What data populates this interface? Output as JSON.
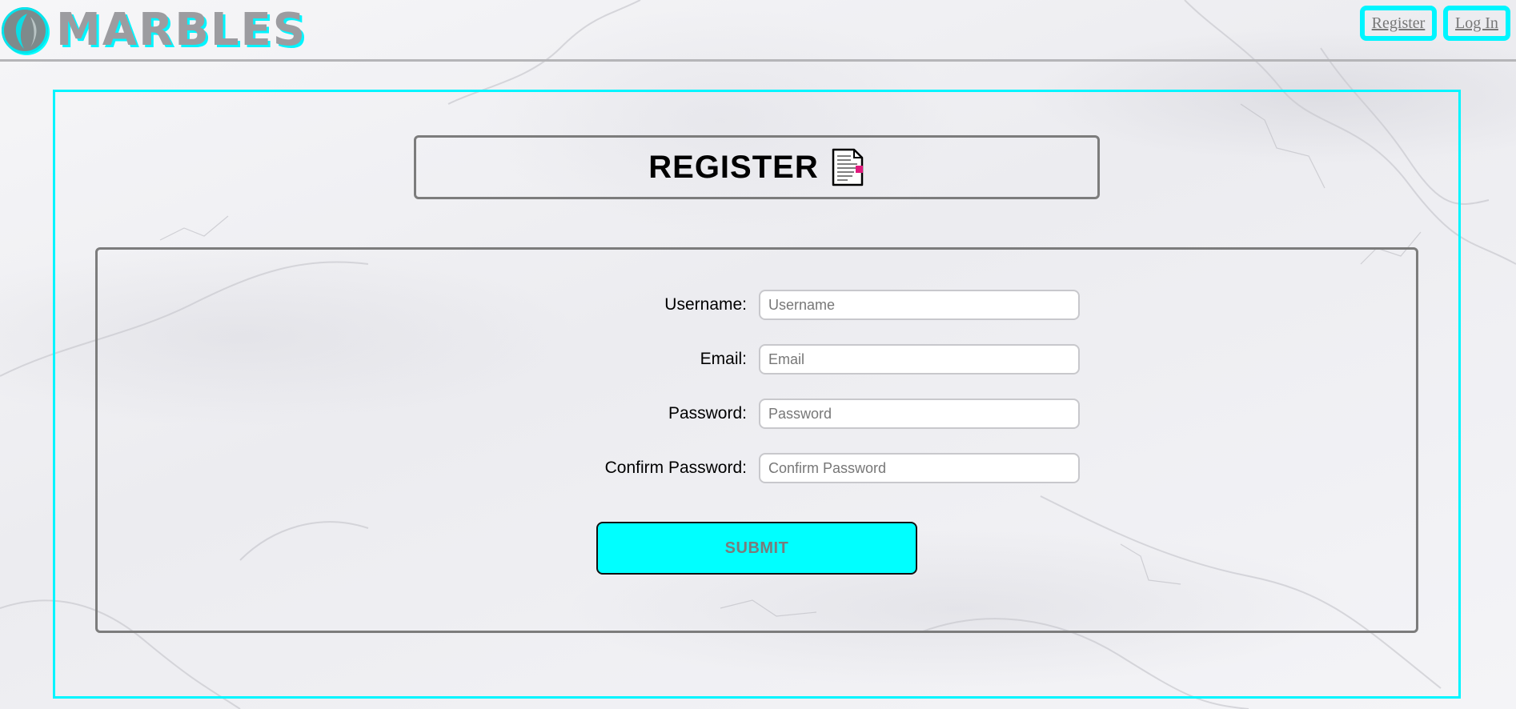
{
  "header": {
    "logo_text": "MARBLES",
    "nav": {
      "register_label": "Register",
      "login_label": "Log In"
    }
  },
  "page": {
    "title": "REGISTER",
    "title_icon": "document-icon"
  },
  "form": {
    "fields": [
      {
        "label": "Username:",
        "placeholder": "Username",
        "value": ""
      },
      {
        "label": "Email:",
        "placeholder": "Email",
        "value": ""
      },
      {
        "label": "Password:",
        "placeholder": "Password",
        "value": ""
      },
      {
        "label": "Confirm Password:",
        "placeholder": "Confirm Password",
        "value": ""
      }
    ],
    "submit_label": "SUBMIT"
  },
  "colors": {
    "accent": "#00ffff",
    "border_gray": "#7c7c7c",
    "logo_text": "#9c9ca0",
    "background": "#f1f1f4"
  }
}
